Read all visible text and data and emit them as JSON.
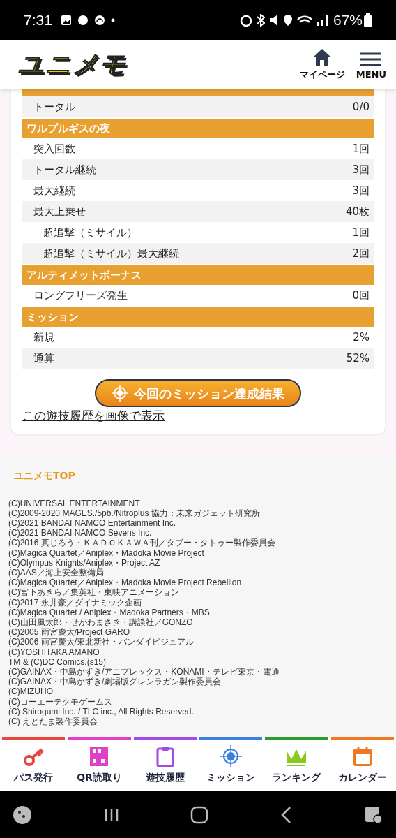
{
  "status_bar": {
    "time": "7:31",
    "battery": "67%"
  },
  "header": {
    "logo": "ユニメモ",
    "actions": [
      {
        "kind": "home",
        "label": "マイページ"
      },
      {
        "kind": "menu",
        "label": "MENU"
      }
    ]
  },
  "sections": [
    {
      "rows": [
        {
          "label": "トータル",
          "value": "0/0"
        }
      ]
    },
    {
      "title": "ワルプルギスの夜",
      "rows": [
        {
          "label": "突入回数",
          "value": "1回"
        },
        {
          "label": "トータル継続",
          "value": "3回"
        },
        {
          "label": "最大継続",
          "value": "3回"
        },
        {
          "label": "最大上乗せ",
          "value": "40枚",
          "children": [
            {
              "label": "超追撃（ミサイル）",
              "value": "1回"
            },
            {
              "label": "超追撃（ミサイル）最大継続",
              "value": "2回"
            }
          ]
        }
      ]
    },
    {
      "title": "アルティメットボーナス",
      "rows": [
        {
          "label": "ロングフリーズ発生",
          "value": "0回"
        }
      ]
    },
    {
      "title": "ミッション",
      "rows": [
        {
          "label": "新規",
          "value": "2%"
        },
        {
          "label": "通算",
          "value": "52%"
        }
      ]
    }
  ],
  "mission_button": "今回のミッション達成結果",
  "image_link": "この遊技履歴を画像で表示",
  "footer_link": "ユニメモTOP",
  "copyrights": [
    "(C)UNIVERSAL ENTERTAINMENT",
    "(C)2009-2020 MAGES./5pb./Nitroplus 協力：未来ガジェット研究所",
    "(C)2021 BANDAI NAMCO Entertainment Inc.",
    "(C)2021 BANDAI NAMCO Sevens Inc.",
    "(C)2016 真じろう・ＫＡＤＯＫＡＷＡ刊／タブー・タトゥー製作委員会",
    "(C)Magica Quartet／Aniplex・Madoka Movie Project",
    "(C)Olympus Knights/Aniplex・Project AZ",
    "(C)AAS／海上安全整備局",
    "(C)Magica Quartet／Aniplex・Madoka Movie Project Rebellion",
    "(C)宮下あきら／集英社・東映アニメーション",
    "(C)2017 永井豪／ダイナミック企画",
    "(C)Magica Quartet / Aniplex・Madoka Partners・MBS",
    "(C)山田風太郎・せがわまさき・講談社／GONZO",
    "(C)2005 雨宮慶太/Project GARO",
    "(C)2006 雨宮慶太/東北新社・バンダイビジュアル",
    "(C)YOSHITAKA AMANO",
    "TM & (C)DC Comics.(s15)",
    "(C)GAINAX・中島かずき/アニプレックス・KONAMI・テレビ東京・電通",
    "(C)GAINAX・中島かずき/劇場版グレンラガン製作委員会",
    "(C)MIZUHO",
    "(C)コーエーテクモゲームス",
    "(C) Shirogumi Inc. / TLC inc., All Rights Reserved.",
    "(C) えとたま製作委員会"
  ],
  "bottom_nav": [
    {
      "kind": "key",
      "label": "パス発行",
      "color": "#e8463c"
    },
    {
      "kind": "qr",
      "label": "QR読取り",
      "color": "#e040c8"
    },
    {
      "kind": "clipboard",
      "label": "遊技履歴",
      "color": "#a24be0"
    },
    {
      "kind": "target",
      "label": "ミッション",
      "color": "#3a80e0"
    },
    {
      "kind": "crown",
      "label": "ランキング",
      "color": "#2e9a2e"
    },
    {
      "kind": "calendar",
      "label": "カレンダー",
      "color": "#f07820"
    }
  ]
}
